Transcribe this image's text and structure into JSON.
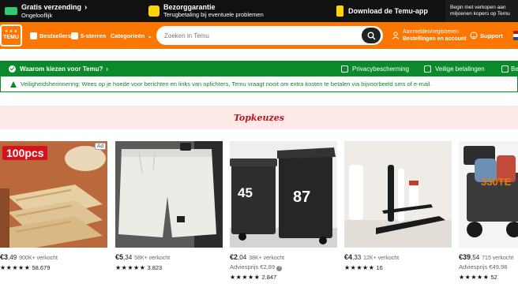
{
  "promo": {
    "shipping_title": "Gratis verzending",
    "shipping_sub": "Ongelooflijk",
    "guarantee_title": "Bezorggarantie",
    "guarantee_sub": "Terugbetaling bij eventuele problemen",
    "app_label": "Download de Temu-app",
    "seller_line1": "Begin met verkopen aan",
    "seller_line2": "miljoenen kopers op Temu"
  },
  "nav": {
    "logo": "TEMU",
    "bestsellers": "Bestsellers",
    "five_star": "5-sterren",
    "categories": "Categorieën",
    "search_placeholder": "Zoeken in Temu",
    "account_line1": "Aanmelden/registreren",
    "account_line2": "Bestellingen en account",
    "support": "Support"
  },
  "trust": {
    "why": "Waarom kiezen voor Temu?",
    "privacy": "Privacybescherming",
    "payments": "Veilige betalingen",
    "cut_text": "Be"
  },
  "warning": "Veiligheidsherinnering: Wees op je hoede voor berichten en links van oplichters, Temu vraagt nooit om extra kosten te betalen via bijvoorbeeld sms of e-mail.",
  "section_title": "Topkeuzes",
  "products": [
    {
      "price_euros": "€3",
      "price_cents": ",49",
      "sold": "900K+ verkocht",
      "advice": "",
      "stars": "★★★★★",
      "reviews": "58.679",
      "badge": "100pcs",
      "ad": "Ad"
    },
    {
      "price_euros": "€5",
      "price_cents": ",34",
      "sold": "58K+ verkocht",
      "advice": "",
      "stars": "★★★★★",
      "reviews": "3.823"
    },
    {
      "price_euros": "€2",
      "price_cents": ",04",
      "sold": "38K+ verkocht",
      "advice": "Adviesprijs €2,89",
      "stars": "★★★★★",
      "reviews": "2.847",
      "bin_left": "45",
      "bin_right": "87"
    },
    {
      "price_euros": "€4",
      "price_cents": ",33",
      "sold": "12K+ verkocht",
      "advice": "",
      "stars": "★★★★★",
      "reviews": "16"
    },
    {
      "price_euros": "€39",
      "price_cents": ",54",
      "sold": "715 verkocht",
      "advice": "Adviesprijs €49,98",
      "stars": "★★★★★",
      "reviews": "52",
      "overlay": "330TE"
    }
  ],
  "colors": {
    "temu_orange": "#fb7701",
    "trust_green": "#0a8a2b",
    "promo_black": "#111111",
    "title_red": "#b5131d"
  }
}
